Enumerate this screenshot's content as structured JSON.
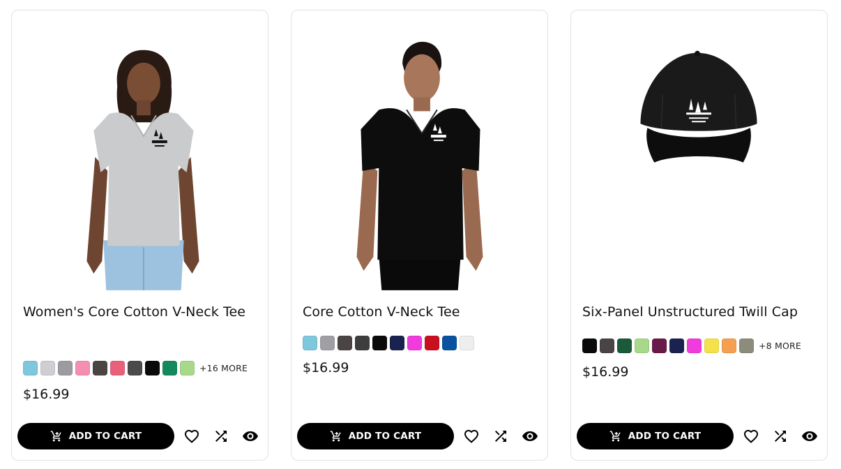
{
  "products": [
    {
      "title": "Women's Core Cotton V-Neck Tee",
      "swatches": [
        "#7ec7dc",
        "#cfcfd3",
        "#9c9ca0",
        "#f48fb1",
        "#4a4444",
        "#e8607a",
        "#4b4b4b",
        "#0a0a0a",
        "#128a5e",
        "#a8d88a"
      ],
      "more_label": "+16 MORE",
      "price": "$16.99",
      "add_to_cart_label": "ADD TO CART",
      "image_icon": "tshirt-grey-icon"
    },
    {
      "title": "Core Cotton V-Neck Tee",
      "swatches": [
        "#7ec7dc",
        "#a0a0a4",
        "#4a4444",
        "#3d3d3d",
        "#0a0a0a",
        "#1a2350",
        "#f03cdc",
        "#c8101e",
        "#0a52a0",
        "#eeeeee"
      ],
      "more_label": "",
      "price": "$16.99",
      "add_to_cart_label": "ADD TO CART",
      "image_icon": "tshirt-black-icon"
    },
    {
      "title": "Six-Panel Unstructured Twill Cap",
      "swatches": [
        "#0a0a0a",
        "#4a4444",
        "#1a5a3a",
        "#a8d88a",
        "#6a1a48",
        "#1a2350",
        "#f03cdc",
        "#f4e24a",
        "#f4a050",
        "#8c8c7c"
      ],
      "more_label": "+8 MORE",
      "price": "$16.99",
      "add_to_cart_label": "ADD TO CART",
      "image_icon": "cap-black-icon"
    }
  ],
  "icons": {
    "cart": "cart-icon",
    "wishlist": "heart-icon",
    "compare": "shuffle-icon",
    "quick_view": "eye-icon"
  }
}
